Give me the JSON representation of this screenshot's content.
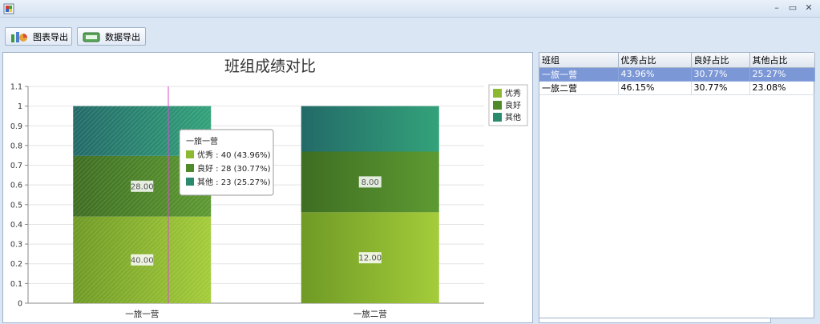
{
  "toolbar": {
    "export_chart_label": "图表导出",
    "export_data_label": "数据导出"
  },
  "chart_data": {
    "type": "bar",
    "stacked": true,
    "title": "班组成绩对比",
    "categories": [
      "一旅一营",
      "一旅二营"
    ],
    "series": [
      {
        "name": "优秀",
        "values": [
          0.4396,
          0.4615
        ],
        "labels": [
          "40.00",
          "12.00"
        ],
        "color": "#8db832"
      },
      {
        "name": "良好",
        "values": [
          0.3077,
          0.3077
        ],
        "labels": [
          "28.00",
          "8.00"
        ],
        "color": "#4f8a2a"
      },
      {
        "name": "其他",
        "values": [
          0.2527,
          0.2308
        ],
        "labels": [
          "",
          ""
        ],
        "color": "#2a8a6e"
      }
    ],
    "ylim": [
      0,
      1.1
    ],
    "yticks": [
      "0",
      "0.1",
      "0.2",
      "0.3",
      "0.4",
      "0.5",
      "0.6",
      "0.7",
      "0.8",
      "0.9",
      "1",
      "1.1"
    ],
    "grid": true,
    "legend_position": "right",
    "tooltip": {
      "title": "一旅一营",
      "items": [
        "优秀 : 40 (43.96%)",
        "良好 : 28 (30.77%)",
        "其他 : 23 (25.27%)"
      ]
    }
  },
  "grid": {
    "columns": [
      "班组",
      "优秀占比",
      "良好占比",
      "其他占比"
    ],
    "rows": [
      [
        "一旅一营",
        "43.96%",
        "30.77%",
        "25.27%"
      ],
      [
        "一旅二营",
        "46.15%",
        "30.77%",
        "23.08%"
      ]
    ],
    "selected_row": 0
  },
  "colors": {
    "accent": "#7b97d6",
    "crosshair": "#d94bd1"
  }
}
